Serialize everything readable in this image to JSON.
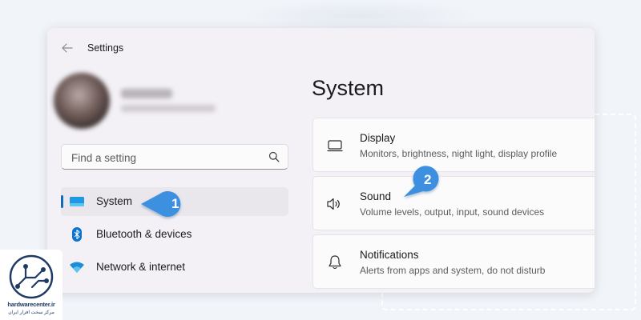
{
  "window": {
    "title": "Settings"
  },
  "search": {
    "placeholder": "Find a setting"
  },
  "sidebar": {
    "items": [
      {
        "label": "System",
        "icon": "monitor-icon",
        "selected": true
      },
      {
        "label": "Bluetooth & devices",
        "icon": "bluetooth-icon",
        "selected": false
      },
      {
        "label": "Network & internet",
        "icon": "wifi-icon",
        "selected": false
      }
    ]
  },
  "main": {
    "title": "System",
    "cards": [
      {
        "title": "Display",
        "description": "Monitors, brightness, night light, display profile",
        "icon": "display-icon"
      },
      {
        "title": "Sound",
        "description": "Volume levels, output, input, sound devices",
        "icon": "speaker-icon"
      },
      {
        "title": "Notifications",
        "description": "Alerts from apps and system, do not disturb",
        "icon": "bell-icon"
      }
    ]
  },
  "callouts": [
    {
      "number": "1",
      "color": "#3d8fe0"
    },
    {
      "number": "2",
      "color": "#3d8fe0"
    }
  ],
  "watermark": {
    "brand": "hardwarecenter.ir",
    "subtitle": "مرکز سخت افزار ایران"
  },
  "colors": {
    "accent": "#0f6cbd",
    "window_bg": "#f3f1f6",
    "card_bg": "#fbfbfc"
  }
}
